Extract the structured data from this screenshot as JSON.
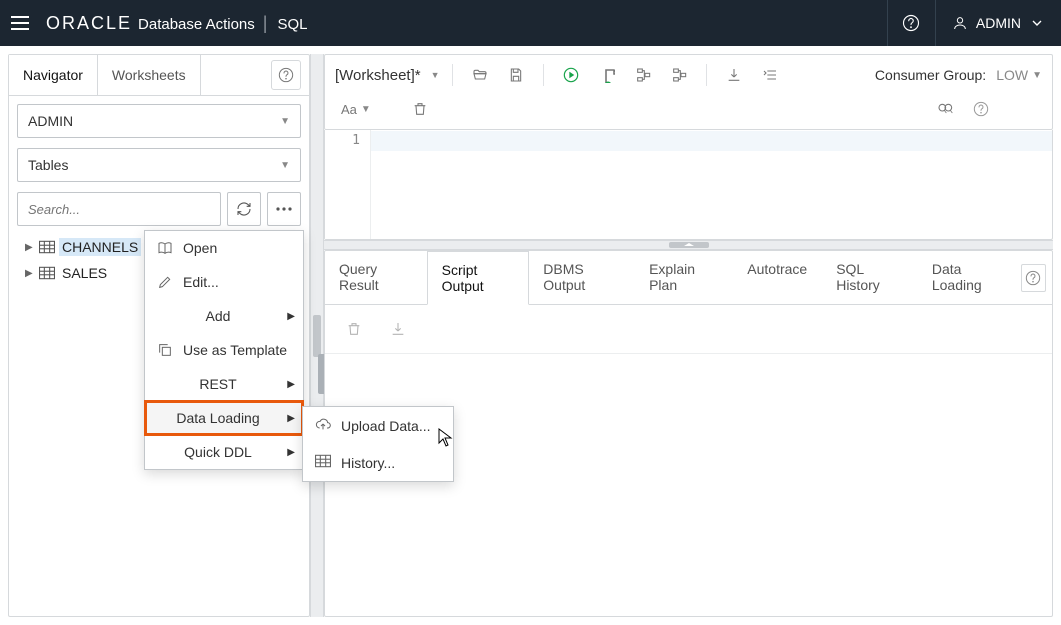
{
  "topbar": {
    "brand": "ORACLE",
    "product": "Database Actions",
    "section": "SQL",
    "user": "ADMIN"
  },
  "sidebar": {
    "tabs": {
      "navigator": "Navigator",
      "worksheets": "Worksheets"
    },
    "schema": "ADMIN",
    "object_type": "Tables",
    "search_placeholder": "Search...",
    "tree": [
      {
        "label": "CHANNELS",
        "selected": true
      },
      {
        "label": "SALES",
        "selected": false
      }
    ]
  },
  "context_menu": {
    "items": [
      {
        "label": "Open",
        "icon": "book-open-icon"
      },
      {
        "label": "Edit...",
        "icon": "pencil-icon"
      },
      {
        "label": "Add",
        "submenu": true,
        "center": true
      },
      {
        "label": "Use as Template",
        "icon": "copy-icon"
      },
      {
        "label": "REST",
        "submenu": true,
        "center": true
      },
      {
        "label": "Data Loading",
        "submenu": true,
        "center": true,
        "highlight": true
      },
      {
        "label": "Quick DDL",
        "submenu": true,
        "center": true
      }
    ],
    "data_loading_submenu": [
      {
        "label": "Upload Data...",
        "icon": "cloud-upload-icon"
      },
      {
        "label": "History...",
        "icon": "table-icon"
      }
    ]
  },
  "toolbar": {
    "worksheet_name": "[Worksheet]*",
    "consumer_group_label": "Consumer Group:",
    "consumer_group_value": "LOW"
  },
  "editor": {
    "line_number": "1"
  },
  "results": {
    "tabs": [
      "Query Result",
      "Script Output",
      "DBMS Output",
      "Explain Plan",
      "Autotrace",
      "SQL History",
      "Data Loading"
    ],
    "active_idx": 1
  }
}
